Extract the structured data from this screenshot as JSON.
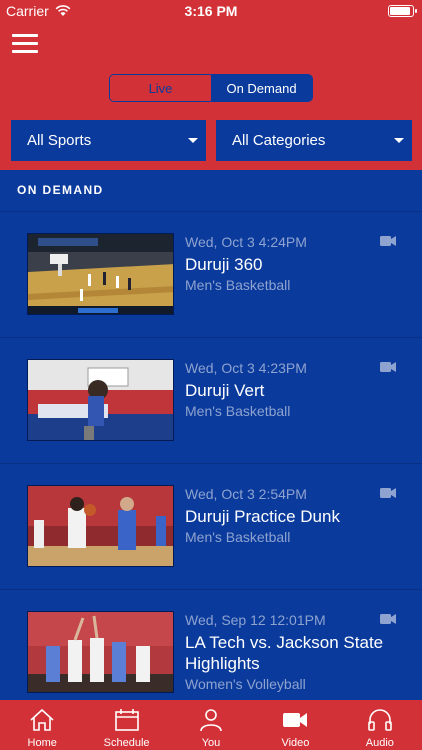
{
  "status_bar": {
    "carrier": "Carrier",
    "time": "3:16 PM",
    "battery_level": 0.95
  },
  "segmented": {
    "live": "Live",
    "on_demand": "On Demand",
    "selected": "On Demand"
  },
  "filters": {
    "sports": "All Sports",
    "categories": "All Categories"
  },
  "section": {
    "title": "ON DEMAND"
  },
  "videos": [
    {
      "date": "Wed, Oct 3 4:24PM",
      "title": "Duruji 360",
      "category": "Men's Basketball",
      "icon": "video-camera-icon"
    },
    {
      "date": "Wed, Oct 3 4:23PM",
      "title": "Duruji Vert",
      "category": "Men's Basketball",
      "icon": "video-camera-icon"
    },
    {
      "date": "Wed, Oct 3 2:54PM",
      "title": "Duruji Practice Dunk",
      "category": "Men's Basketball",
      "icon": "video-camera-icon"
    },
    {
      "date": "Wed, Sep 12 12:01PM",
      "title": "LA Tech vs. Jackson State Highlights",
      "category": "Women's Volleyball",
      "icon": "video-camera-icon"
    }
  ],
  "tabs": [
    {
      "label": "Home",
      "icon": "home-icon"
    },
    {
      "label": "Schedule",
      "icon": "calendar-icon"
    },
    {
      "label": "You",
      "icon": "person-icon"
    },
    {
      "label": "Video",
      "icon": "video-camera-icon"
    },
    {
      "label": "Audio",
      "icon": "headphones-icon"
    }
  ],
  "colors": {
    "brand_red": "#d23237",
    "brand_blue": "#0a3a9c",
    "muted_text": "#8ea3cf"
  }
}
